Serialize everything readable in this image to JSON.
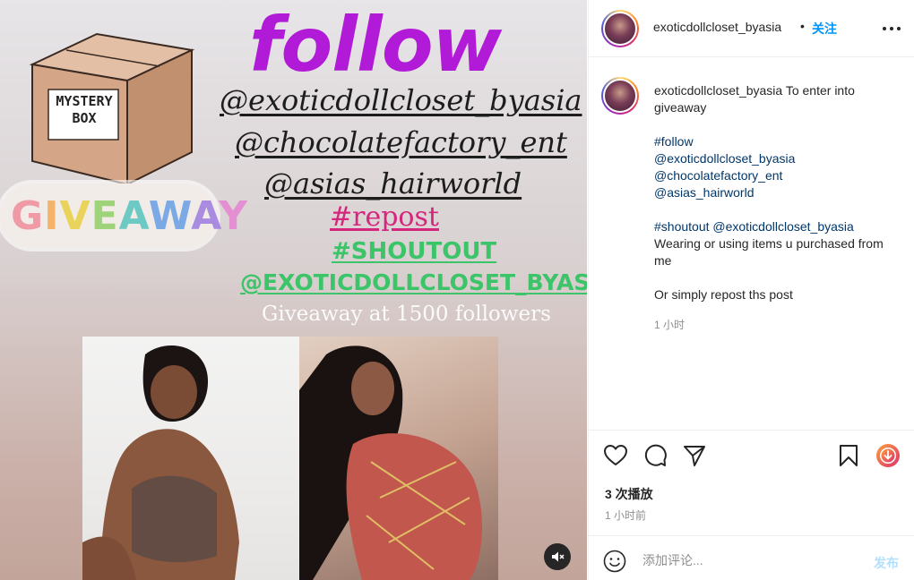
{
  "media": {
    "box_label_line1": "MYSTERY",
    "box_label_line2": "BOX",
    "giveaway_letters": [
      "G",
      "I",
      "V",
      "E",
      "A",
      "W",
      "A",
      "Y"
    ],
    "follow_title": "follow",
    "handles": [
      "@exoticdollcloset_byasia",
      "@chocolatefactory_ent",
      "@asias_hairworld"
    ],
    "repost": "#repost",
    "shoutout": "#SHOUTOUT",
    "shoutout_handle": "@EXOTICDOLLCLOSET_BYASIA",
    "goal": "Giveaway at 1500 followers",
    "mute_icon": "speaker-muted-icon"
  },
  "header": {
    "username": "exoticdollcloset_byasia",
    "dot": "•",
    "follow_label": "关注",
    "more_icon": "more-horizontal-icon"
  },
  "caption": {
    "username": "exoticdollcloset_byasia",
    "intro": " To enter into giveaway",
    "tags": [
      "#follow",
      "@exoticdollcloset_byasia",
      "@chocolatefactory_ent",
      "@asias_hairworld"
    ],
    "shoutout_tag": "#shoutout",
    "shoutout_mention": "@exoticdollcloset_byasia",
    "shoutout_text": "Wearing or using items u purchased from me",
    "repost_text": "Or simply repost ths post",
    "time": "1 小时"
  },
  "actions": {
    "icons": [
      "heart-icon",
      "comment-icon",
      "share-icon",
      "bookmark-icon",
      "download-icon"
    ],
    "views": "3 次播放",
    "time": "1 小时前"
  },
  "comment": {
    "placeholder": "添加评论...",
    "post_label": "发布",
    "emoji_icon": "smiley-icon"
  },
  "colors": {
    "accent_blue": "#0095f6",
    "link_blue": "#00376b",
    "follow_purple": "#b11ad6",
    "repost_pink": "#d4267d",
    "shoutout_green": "#3cc468"
  }
}
